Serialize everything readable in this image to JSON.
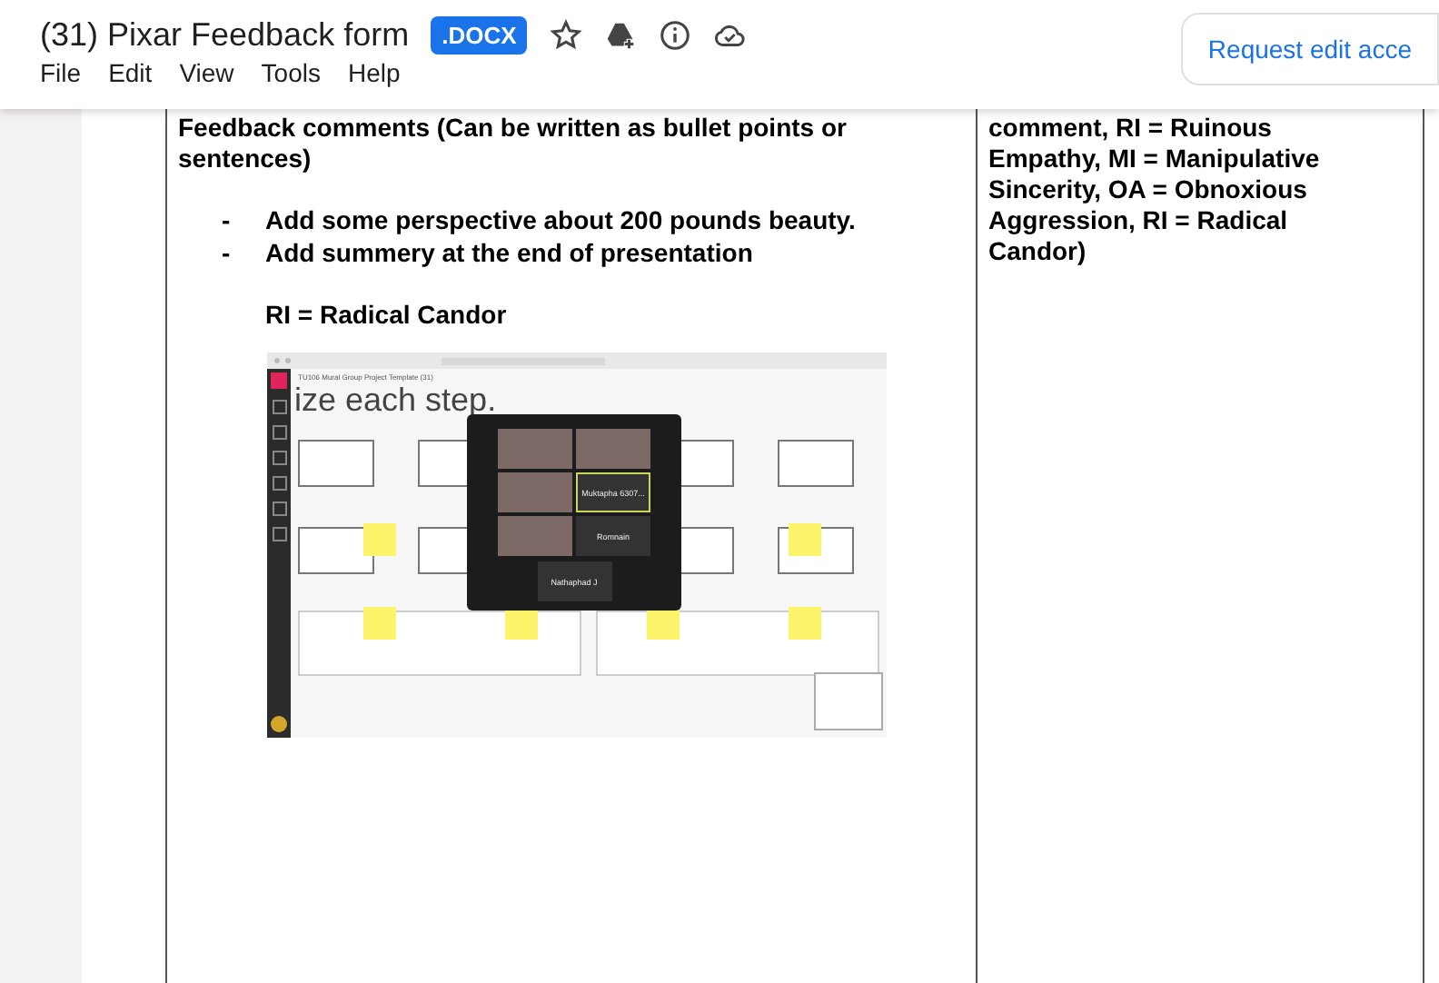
{
  "header": {
    "title": "(31) Pixar Feedback form",
    "badge": ".DOCX",
    "request_button": "Request edit acce"
  },
  "menu": [
    "File",
    "Edit",
    "View",
    "Tools",
    "Help"
  ],
  "table": {
    "left_cell": {
      "heading": "Feedback comments (Can be written as bullet points or sentences)",
      "bullets": [
        {
          "marker": "-",
          "text": "Add some perspective about 200 pounds beauty."
        },
        {
          "marker": "-",
          "text": "Add summery at the end of presentation"
        }
      ],
      "note": "RI = Radical Candor"
    },
    "right_cell": {
      "text": "comment, RI = Ruinous Empathy, MI = Manipulative Sincerity, OA = Obnoxious Aggression, RI = Radical Candor)"
    }
  },
  "embedded_screenshot": {
    "board_title": "TU106 Mural Group Project Template (31)",
    "canvas_heading": "ize each step.",
    "call_tiles": [
      {
        "kind": "video",
        "speaking": false
      },
      {
        "kind": "video",
        "speaking": false
      },
      {
        "kind": "video",
        "speaking": false
      },
      {
        "kind": "name",
        "label": "Muktapha 6307...",
        "speaking": true
      },
      {
        "kind": "video",
        "speaking": false
      },
      {
        "kind": "name",
        "label": "Romnain",
        "speaking": false
      }
    ],
    "call_bottom": "Nathaphad J"
  }
}
